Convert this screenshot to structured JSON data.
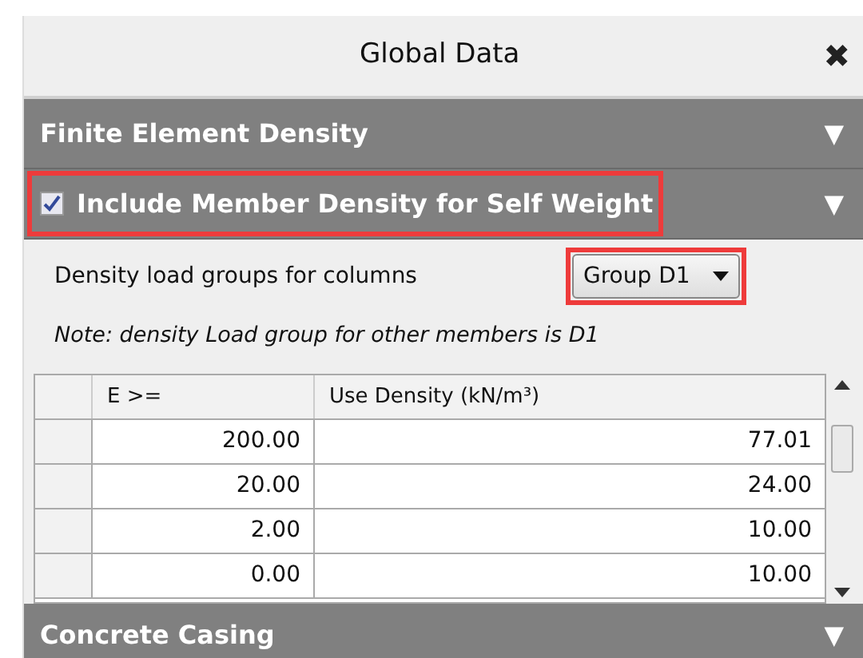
{
  "window": {
    "title": "Global Data",
    "close": "✖"
  },
  "sections": [
    {
      "kind": "plain",
      "label": "Finite Element Density",
      "arrow": "▼",
      "highlighted": false
    },
    {
      "kind": "checkbox",
      "label": "Include Member Density for Self Weight",
      "checked": true,
      "arrow": "▼",
      "highlighted": true
    }
  ],
  "density_group": {
    "label": "Density load groups for columns",
    "value": "Group D1",
    "highlighted": true
  },
  "note": "Note: density Load group for other members is D1",
  "table": {
    "columns": [
      "E >=",
      "Use Density (kN/m³)"
    ],
    "rows": [
      [
        "200.00",
        "77.01"
      ],
      [
        "20.00",
        "24.00"
      ],
      [
        "2.00",
        "10.00"
      ],
      [
        "0.00",
        "10.00"
      ]
    ]
  },
  "footer_section": {
    "label": "Concrete Casing",
    "arrow": "▼"
  }
}
